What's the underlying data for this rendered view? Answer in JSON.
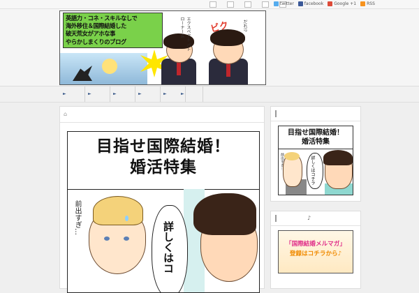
{
  "topbar": {
    "links": [
      {
        "icon": "twitter-icon",
        "label": "twitter"
      },
      {
        "icon": "facebook-icon",
        "label": "facebook"
      },
      {
        "icon": "google-plus-icon",
        "label": "Google +1"
      },
      {
        "icon": "rss-icon",
        "label": "RSS"
      }
    ]
  },
  "header": {
    "banner_lines": [
      "英語力・コネ・スキルなしで",
      "海外移住＆国際結婚した",
      "破天荒女がアホな事",
      "やらかしまくりのブログ"
    ],
    "sfx_main": "ビク",
    "sfx_small1": "エクスペクト パトローナーム",
    "sfx_small2": "だれ!?"
  },
  "nav": {
    "items": [
      "",
      "",
      "",
      "",
      "",
      ""
    ]
  },
  "main": {
    "manga": {
      "title_line1": "目指せ国際結婚！",
      "title_line2": "婚活特集",
      "side_text": "前出すぎ…",
      "bubble_text": "詳しくはコ"
    }
  },
  "sidebar": {
    "widget1": {
      "title_line1": "目指せ国際結婚！",
      "title_line2": "婚活特集",
      "bubble_text": "詳しくはコチラ",
      "side_text": "前出すぎ…"
    },
    "widget2": {
      "note": "♪",
      "line1": "「国際結婚メルマガ」",
      "line2": "登録はコチラから♪"
    }
  }
}
